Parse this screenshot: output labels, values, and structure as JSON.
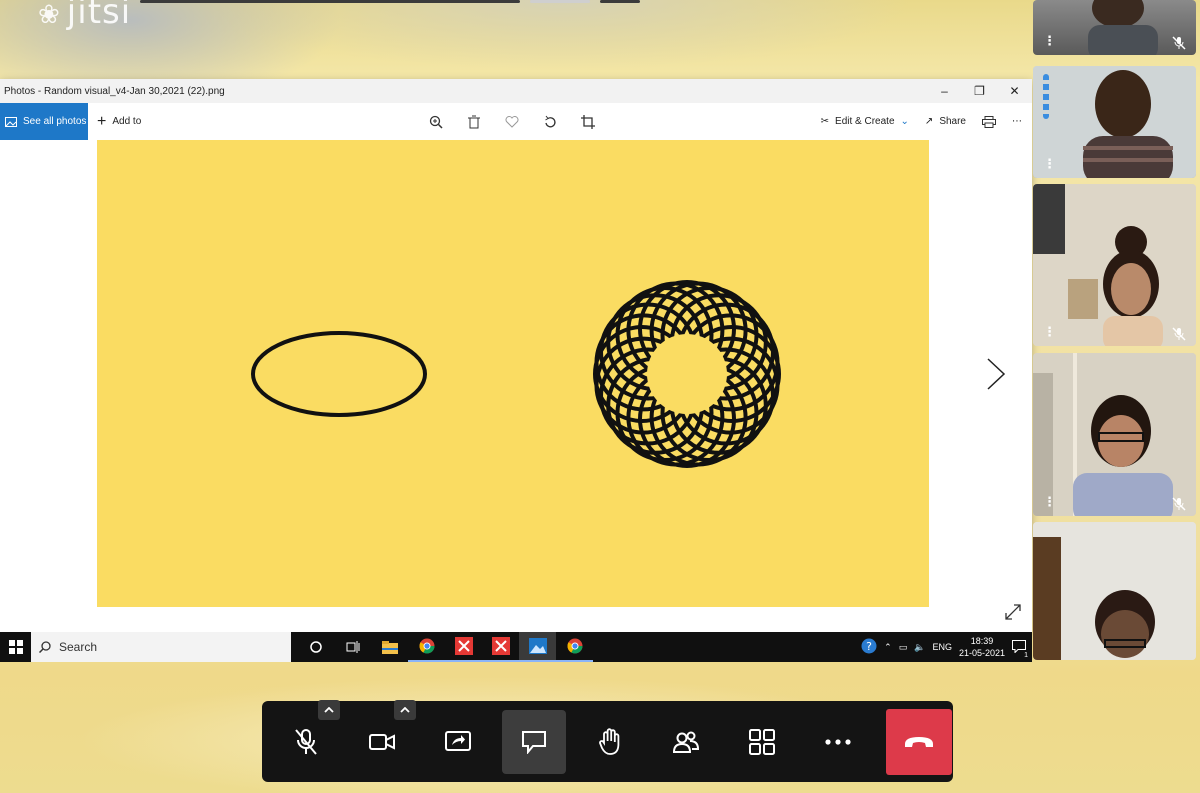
{
  "app": {
    "logo_text": "jitsi"
  },
  "photos": {
    "window_title": "Photos - Random visual_v4-Jan 30,2021 (22).png",
    "see_all_label": "See all photos",
    "add_to_label": "Add to",
    "edit_create_label": "Edit & Create",
    "share_label": "Share"
  },
  "taskbar": {
    "search_placeholder": "Search",
    "language": "ENG",
    "time": "18:39",
    "date": "21-05-2021",
    "notification_count": "1"
  },
  "colors": {
    "image_background": "#fadc62",
    "accent_blue": "#1e78c8",
    "hangup_red": "#dd3a4a",
    "toolbar_bg": "#141414"
  },
  "participants": [
    {
      "id": "p1",
      "muted": true
    },
    {
      "id": "p2",
      "muted": false
    },
    {
      "id": "p3",
      "muted": true
    },
    {
      "id": "p4",
      "muted": true
    },
    {
      "id": "p5",
      "muted": false
    }
  ]
}
